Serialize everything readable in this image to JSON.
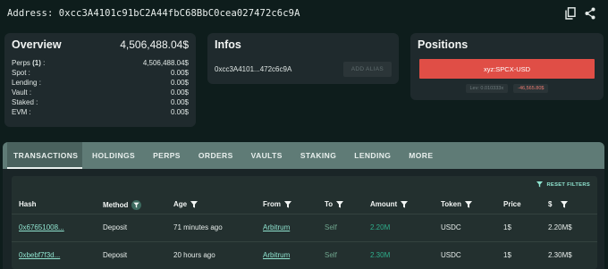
{
  "header": {
    "address_label": "Address: 0xcc3A4101c91bC2A44fbC68BbC0cea027472c6c9A"
  },
  "overview": {
    "title": "Overview",
    "total": "4,506,488.04$",
    "rows": [
      {
        "label": "Perps",
        "count": "(1)",
        "suffix": " :",
        "value": "4,506,488.04$"
      },
      {
        "label": "Spot :",
        "value": "0.00$"
      },
      {
        "label": "Lending :",
        "value": "0.00$"
      },
      {
        "label": "Vault :",
        "value": "0.00$"
      },
      {
        "label": "Staked :",
        "value": "0.00$"
      },
      {
        "label": "EVM :",
        "value": "0.00$"
      }
    ]
  },
  "infos": {
    "title": "Infos",
    "short_address": "0xcc3A4101...472c6c9A",
    "add_alias_label": "ADD ALIAS"
  },
  "positions": {
    "title": "Positions",
    "market": "xyz:SPCX-USD",
    "leverage": "Lev: 0.010333x",
    "pnl": "-46,565.80$",
    "colors": {
      "short": "#e04e46",
      "pnl_negative": "#e8796f"
    }
  },
  "tabs": [
    "TRANSACTIONS",
    "HOLDINGS",
    "PERPS",
    "ORDERS",
    "VAULTS",
    "STAKING",
    "LENDING",
    "MORE"
  ],
  "table": {
    "reset_label": "RESET FILTERS",
    "headers": [
      "Hash",
      "Method",
      "Age",
      "From",
      "To",
      "Amount",
      "Token",
      "Price",
      "$"
    ],
    "rows": [
      {
        "hash": "0x67651008...",
        "method": "Deposit",
        "age": "71 minutes ago",
        "from": "Arbitrum",
        "to": "Self",
        "amount": "2.20M",
        "token": "USDC",
        "price": "1$",
        "usd": "2.20M$"
      },
      {
        "hash": "0xbebf7f3d...",
        "method": "Deposit",
        "age": "20 hours ago",
        "from": "Arbitrum",
        "to": "Self",
        "amount": "2.30M",
        "token": "USDC",
        "price": "1$",
        "usd": "2.30M$"
      }
    ]
  }
}
